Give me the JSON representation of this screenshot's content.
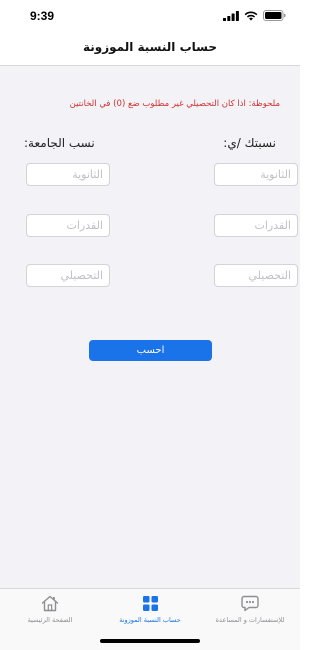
{
  "status_bar": {
    "time": "9:39"
  },
  "nav": {
    "title": "حساب النسبة الموزونة"
  },
  "note": "ملحوظة: اذا كان التحصيلي غير مطلوب ضع (0) في الخانتين",
  "columns": {
    "yours_title": "نسبتك /ي:",
    "university_title": "نسب الجامعة:"
  },
  "fields": {
    "secondary_placeholder": "الثانوية",
    "aptitude_placeholder": "القدرات",
    "achievement_placeholder": "التحصيلي"
  },
  "calculate_button": "احسب",
  "tabs": [
    {
      "label": "للإستفسارات و المساعدة",
      "icon": "chat-icon",
      "active": false
    },
    {
      "label": "حساب النسبة الموزونة",
      "icon": "grid-icon",
      "active": true
    },
    {
      "label": "الصفحة الرئيسية",
      "icon": "home-icon",
      "active": false
    }
  ],
  "colors": {
    "accent": "#1a73e8",
    "note": "#d3302f",
    "background": "#f2f2f7"
  }
}
